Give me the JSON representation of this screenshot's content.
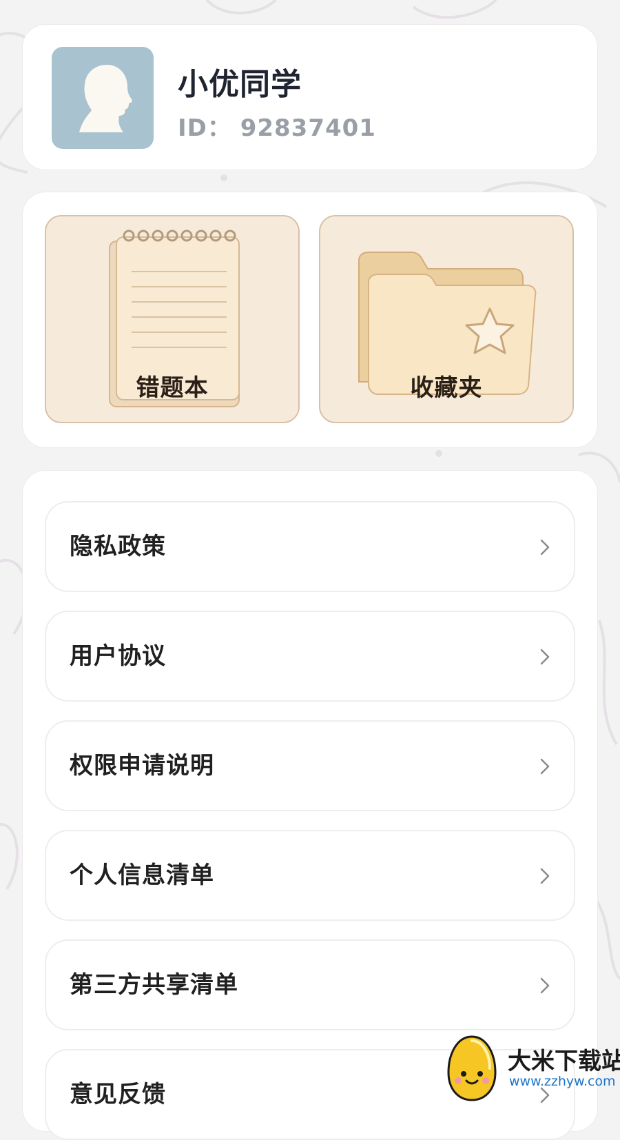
{
  "profile": {
    "username": "小优同学",
    "user_id": "ID：  92837401"
  },
  "features": [
    {
      "label": "错题本",
      "icon": "notebook-icon"
    },
    {
      "label": "收藏夹",
      "icon": "star-folder-icon"
    }
  ],
  "menu": [
    {
      "label": "隐私政策"
    },
    {
      "label": "用户协议"
    },
    {
      "label": "权限申请说明"
    },
    {
      "label": "个人信息清单"
    },
    {
      "label": "第三方共享清单"
    },
    {
      "label": "意见反馈"
    }
  ],
  "watermark": {
    "text": "大米下载站",
    "url": "www.zzhyw.com"
  },
  "colors": {
    "background": "#f4f3f4",
    "card": "#ffffff",
    "avatar_bg": "#a9c2cf",
    "feature_bg": "#f7ecdd",
    "feature_border": "#d9c0a6",
    "id_text": "#9a9fa7"
  }
}
